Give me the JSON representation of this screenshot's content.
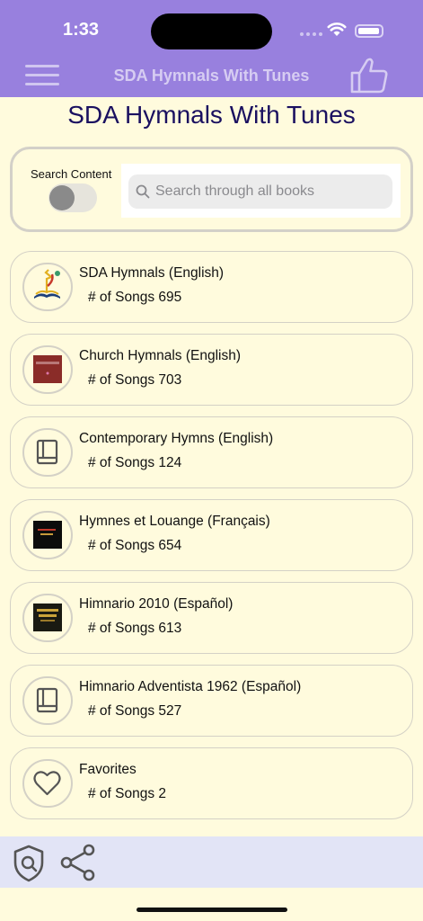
{
  "status": {
    "time": "1:33"
  },
  "navbar": {
    "title": "SDA Hymnals With Tunes"
  },
  "page": {
    "title": "SDA Hymnals With Tunes"
  },
  "search": {
    "label": "Search Content",
    "placeholder": "Search through all books",
    "toggle_on": false
  },
  "books": [
    {
      "name": "SDA Hymnals (English)",
      "count": "# of Songs 695",
      "icon": "sda-logo-icon"
    },
    {
      "name": "Church Hymnals (English)",
      "count": "# of Songs 703",
      "icon": "church-hymnal-cover-icon"
    },
    {
      "name": "Contemporary Hymns (English)",
      "count": "# of Songs 124",
      "icon": "book-icon"
    },
    {
      "name": "Hymnes et Louange (Français)",
      "count": "# of Songs 654",
      "icon": "hymnes-cover-icon"
    },
    {
      "name": "Himnario 2010 (Español)",
      "count": "# of Songs 613",
      "icon": "himnario-cover-icon"
    },
    {
      "name": "Himnario Adventista 1962 (Español)",
      "count": "# of Songs 527",
      "icon": "book-icon"
    },
    {
      "name": "Favorites",
      "count": "# of Songs 2",
      "icon": "heart-icon"
    }
  ],
  "colors": {
    "accent": "#9880de",
    "background": "#fffbdd",
    "title": "#1a1060",
    "bottom_bar": "#e2e4f6"
  }
}
